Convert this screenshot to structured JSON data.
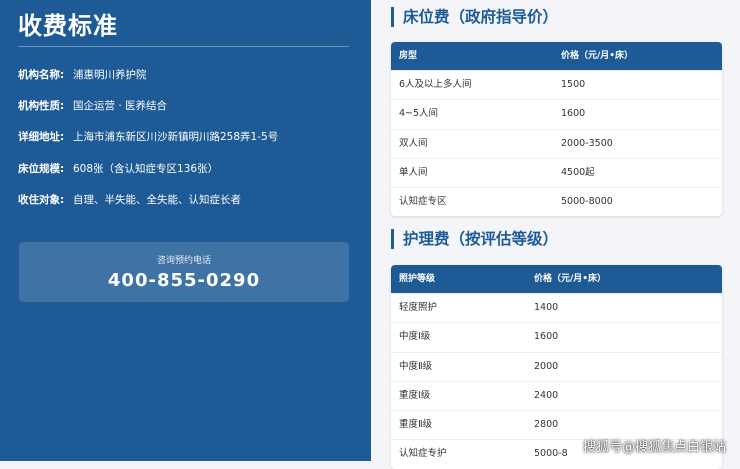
{
  "left": {
    "title": "收费标准",
    "info": [
      {
        "key": "机构名称:",
        "value": "浦惠明川养护院"
      },
      {
        "key": "机构性质:",
        "value": "国企运营 · 医养结合"
      },
      {
        "key": "详细地址:",
        "value": "上海市浦东新区川沙新镇明川路258弄1-5号"
      },
      {
        "key": "床位规模:",
        "value": "608张（含认知症专区136张）"
      },
      {
        "key": "收住对象:",
        "value": "自理、半失能、全失能、认知症长者"
      }
    ],
    "contact": {
      "label": "咨询预约电话",
      "phone": "400-855-0290"
    }
  },
  "bed_section": {
    "title": "床位费（政府指导价）",
    "headers": [
      "房型",
      "价格（元/月•床）"
    ],
    "rows": [
      [
        "6人及以上多人间",
        "1500"
      ],
      [
        "4~5人间",
        "1600"
      ],
      [
        "双人间",
        "2000-3500"
      ],
      [
        "单人间",
        "4500起"
      ],
      [
        "认知症专区",
        "5000-8000"
      ]
    ]
  },
  "care_section": {
    "title": "护理费（按评估等级）",
    "headers": [
      "照护等级",
      "价格（元/月•床）"
    ],
    "rows": [
      [
        "轻度照护",
        "1400"
      ],
      [
        "中度Ⅰ级",
        "1600"
      ],
      [
        "中度Ⅱ级",
        "2000"
      ],
      [
        "重度Ⅰ级",
        "2400"
      ],
      [
        "重度Ⅱ级",
        "2800"
      ],
      [
        "认知症专护",
        "5000-8"
      ]
    ]
  },
  "watermark": "搜狐号@搜狐焦点白银站"
}
